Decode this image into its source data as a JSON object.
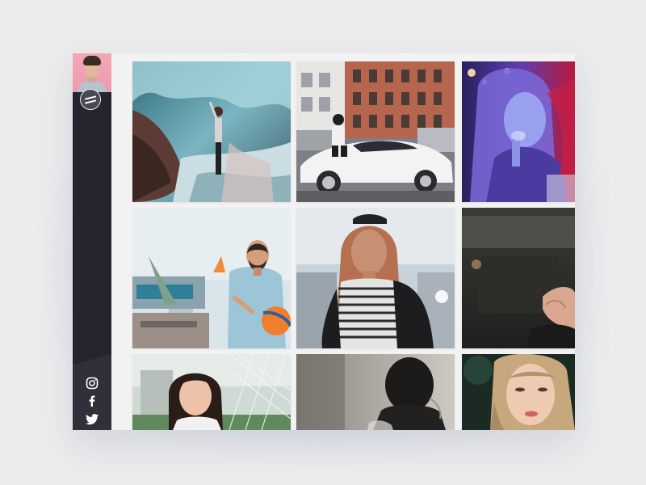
{
  "app": {
    "type": "photo-gallery"
  },
  "sidebar": {
    "avatar": {
      "icon": "user-avatar-photo"
    },
    "menu_toggle": {
      "icon": "hamburger-menu-icon"
    },
    "social": [
      {
        "name": "instagram",
        "icon": "instagram-icon"
      },
      {
        "name": "facebook",
        "icon": "facebook-icon"
      },
      {
        "name": "twitter",
        "icon": "twitter-icon"
      }
    ]
  },
  "gallery": {
    "photos": [
      {
        "id": "cave-hiker",
        "row": 1,
        "col": 1
      },
      {
        "id": "street-car",
        "row": 1,
        "col": 2
      },
      {
        "id": "neon-portrait",
        "row": 1,
        "col": 3
      },
      {
        "id": "bearded-man-ball",
        "row": 2,
        "col": 1
      },
      {
        "id": "striped-shirt-woman",
        "row": 2,
        "col": 2
      },
      {
        "id": "dark-hand-cropped",
        "row": 2,
        "col": 3
      },
      {
        "id": "girl-with-net",
        "row": 3,
        "col": 1
      },
      {
        "id": "child-silhouette",
        "row": 3,
        "col": 2
      },
      {
        "id": "blonde-portrait",
        "row": 3,
        "col": 3
      }
    ]
  },
  "colors": {
    "sidebar": "#25252f",
    "page_background": "#ececed",
    "avatar_background": "#ee9aac"
  }
}
